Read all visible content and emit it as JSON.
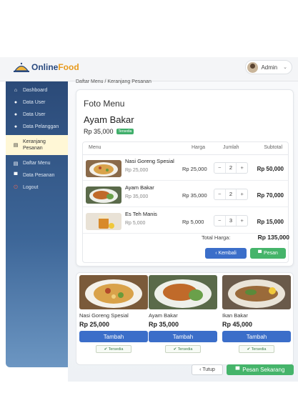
{
  "brand": {
    "part1": "Online",
    "part2": "Food"
  },
  "user": {
    "name": "Admin",
    "chevron": "⌄"
  },
  "sidebar": {
    "items": [
      {
        "label": "Dashboard",
        "icon": "home-icon",
        "glyph": "⌂"
      },
      {
        "label": "Data User",
        "icon": "user-icon",
        "glyph": "●"
      },
      {
        "label": "Data User",
        "icon": "users-icon",
        "glyph": "●"
      },
      {
        "label": "Data Pelanggan",
        "icon": "customers-icon",
        "glyph": "●"
      },
      {
        "label": "Keranjang Pesanan",
        "icon": "cart-icon",
        "glyph": "▤"
      },
      {
        "label": "Daftar Menu",
        "icon": "menu-list-icon",
        "glyph": "▤"
      },
      {
        "label": "Data Pesanan",
        "icon": "orders-icon",
        "glyph": "▀"
      },
      {
        "label": "Logout",
        "icon": "power-icon",
        "glyph": "⏻"
      }
    ]
  },
  "breadcrumb": "Daftar Menu / Keranjang Pesanan",
  "detail": {
    "section_title": "Foto Menu",
    "item_name": "Ayam Bakar",
    "price": "Rp 35,000",
    "status": "Tersedia"
  },
  "cart": {
    "headers": {
      "menu": "Menu",
      "harga": "Harga",
      "jumlah": "Jumlah",
      "subtotal": "Subtotal"
    },
    "rows": [
      {
        "name": "Nasi Goreng Spesial",
        "price": "Rp 25,000",
        "harga": "Rp 25,000",
        "qty": "2",
        "subtotal": "Rp 50,000"
      },
      {
        "name": "Ayam Bakar",
        "price": "Rp 35,000",
        "harga": "Rp 35,000",
        "qty": "2",
        "subtotal": "Rp 70,000"
      },
      {
        "name": "Es Teh Manis",
        "price": "Rp 5,000",
        "harga": "Rp 5,000",
        "qty": "3",
        "subtotal": "Rp 15,000"
      }
    ],
    "total_label": "Total Harga:",
    "total_value": "Rp 135,000",
    "minus": "−",
    "plus": "+"
  },
  "actions": {
    "back": "‹ Kembali",
    "order": "Pesan"
  },
  "products": [
    {
      "name": "Nasi Goreng Spesial",
      "price": "Rp 25,000",
      "button": "Tambah",
      "status": "✔ Tersedia"
    },
    {
      "name": "Ayam Bakar",
      "price": "Rp 35,000",
      "button": "Tambah",
      "status": "✔ Tersedia"
    },
    {
      "name": "Ikan Bakar",
      "price": "Rp 45,000",
      "button": "Tambah",
      "status": "✔ Tersedia"
    }
  ],
  "footer": {
    "close": "‹ Tutup",
    "order_now": "Pesan Sekarang"
  },
  "colors": {
    "primary": "#3b6ec9",
    "success": "#45b46a",
    "sidebar": "#2b4a78",
    "active": "#fff7d6"
  }
}
